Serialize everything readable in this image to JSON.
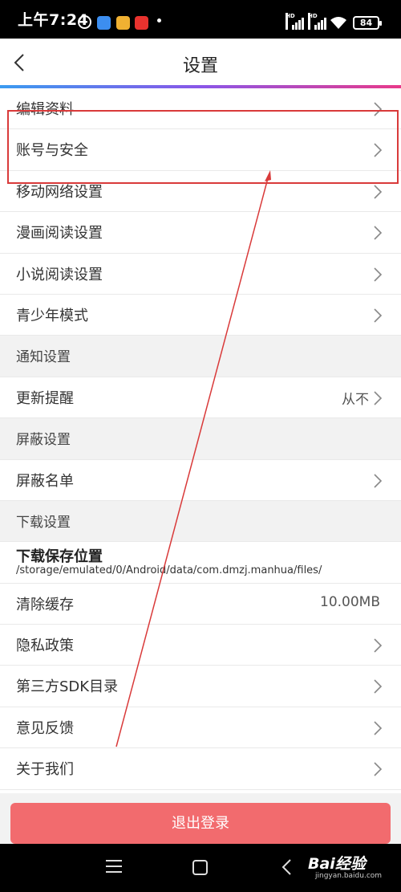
{
  "status_bar": {
    "time": "上午7:24",
    "battery": "84",
    "signal_tag": "HD"
  },
  "header": {
    "title": "设置",
    "back_icon": "chevron-left-icon"
  },
  "settings": {
    "edit_profile": "编辑资料",
    "account_security": "账号与安全",
    "mobile_network": "移动网络设置",
    "comic_reading": "漫画阅读设置",
    "novel_reading": "小说阅读设置",
    "youth_mode": "青少年模式",
    "notification_section": "通知设置",
    "update_reminder": "更新提醒",
    "update_reminder_value": "从不",
    "block_section": "屏蔽设置",
    "block_list": "屏蔽名单",
    "download_section": "下载设置",
    "download_location": "下载保存位置",
    "download_path": "/storage/emulated/0/Android/data/com.dmzj.manhua/files/",
    "clear_cache": "清除缓存",
    "cache_size": "10.00MB",
    "privacy_policy": "隐私政策",
    "sdk_list": "第三方SDK目录",
    "feedback": "意见反馈",
    "about_us": "关于我们"
  },
  "logout_label": "退出登录",
  "watermark": {
    "brand": "Bai经验",
    "url": "jingyan.baidu.com"
  },
  "colors": {
    "accent_line": "#8a56e8",
    "logout_button": "#f26b6e",
    "annotation": "#d93a3a"
  }
}
